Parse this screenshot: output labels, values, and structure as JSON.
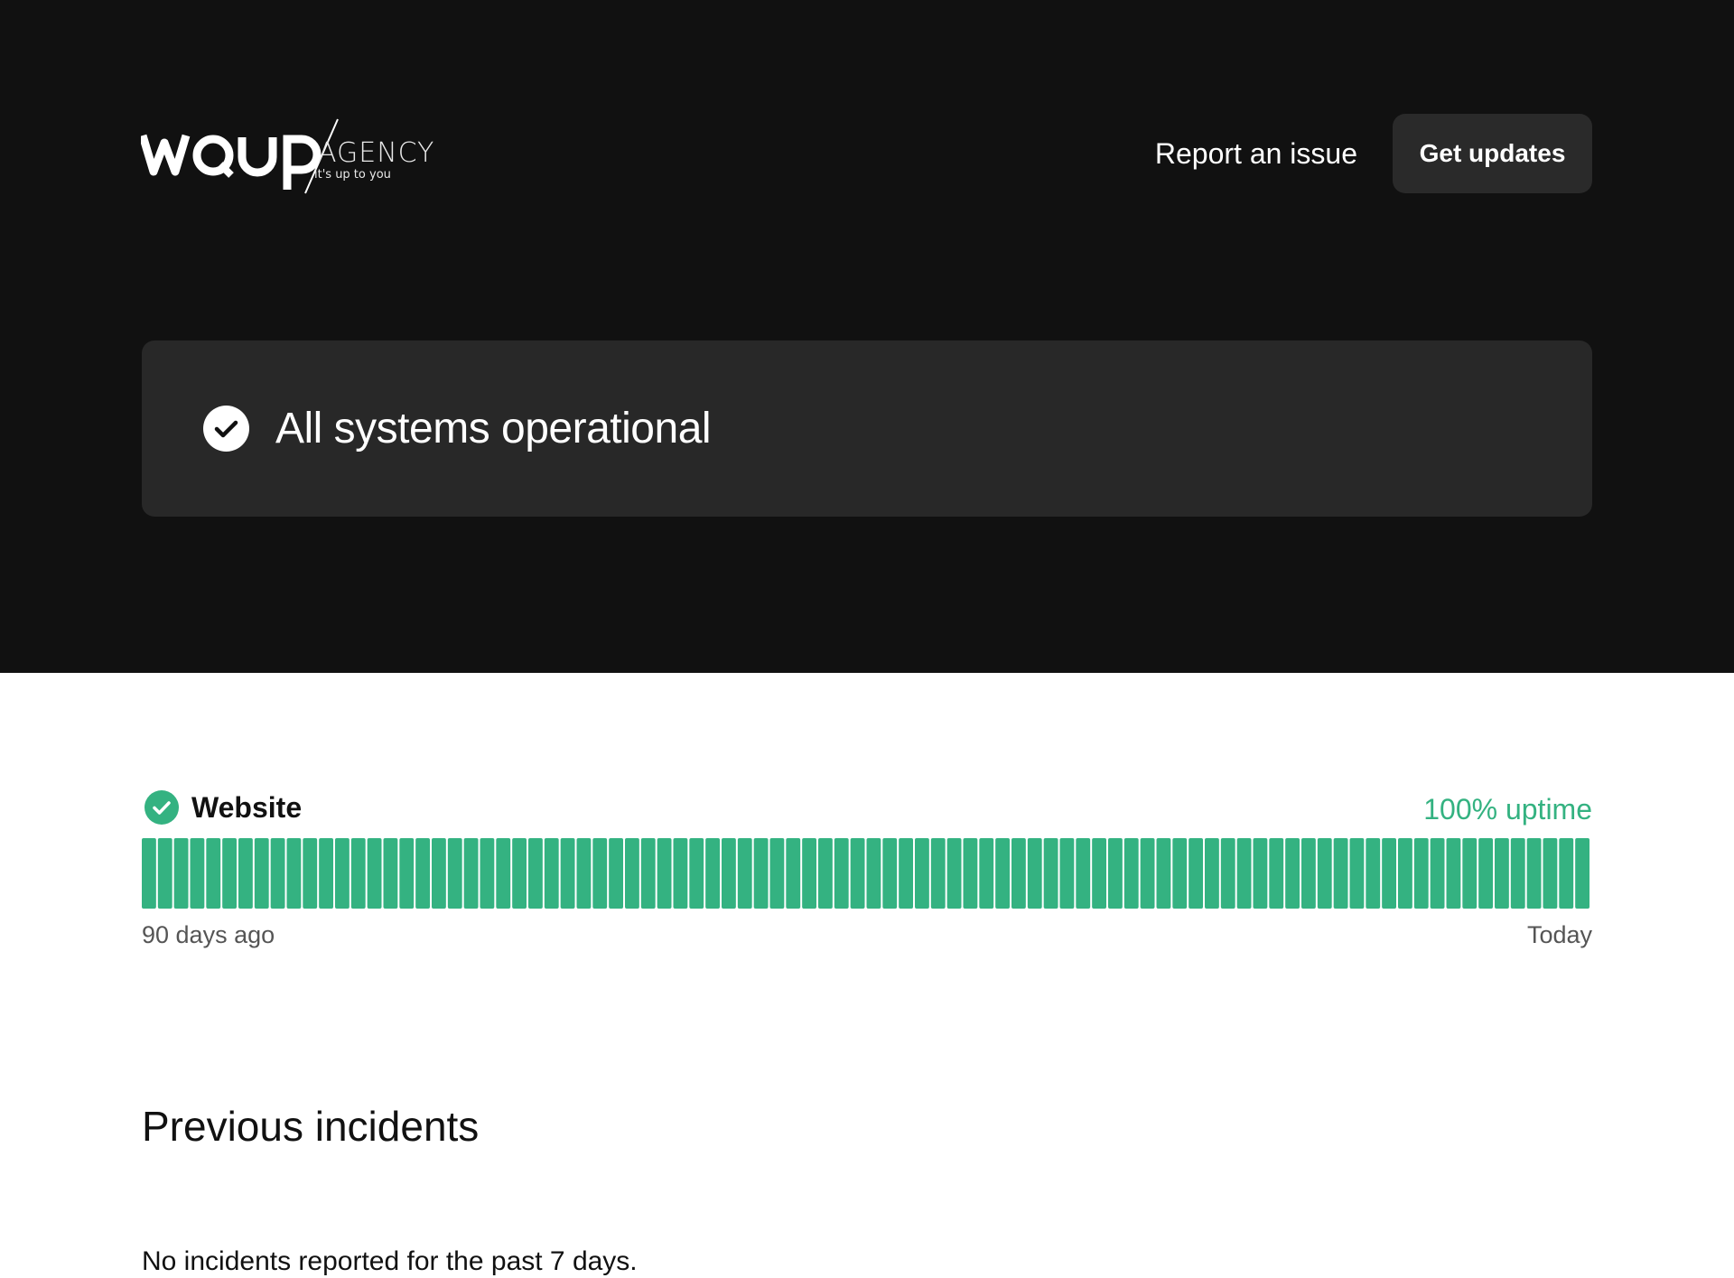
{
  "header": {
    "logo": {
      "wordmark": "AGENCY",
      "tagline": "it's up to you"
    },
    "report_link": "Report an issue",
    "updates_button": "Get updates"
  },
  "status": {
    "message": "All systems operational",
    "icon": "check-circle-icon"
  },
  "components": [
    {
      "name": "Website",
      "uptime_label": "100% uptime",
      "uptime_percent": 100,
      "days": 90,
      "daily_status": "operational",
      "range_start": "90 days ago",
      "range_end": "Today",
      "icon": "check-circle-icon"
    }
  ],
  "incidents": {
    "title": "Previous incidents",
    "empty_message": "No incidents reported for the past 7 days."
  },
  "colors": {
    "hero_bg": "#111111",
    "card_bg": "#282828",
    "button_bg": "#2a2a2a",
    "operational": "#34b281",
    "text_dark": "#111111",
    "text_muted": "#555555"
  }
}
